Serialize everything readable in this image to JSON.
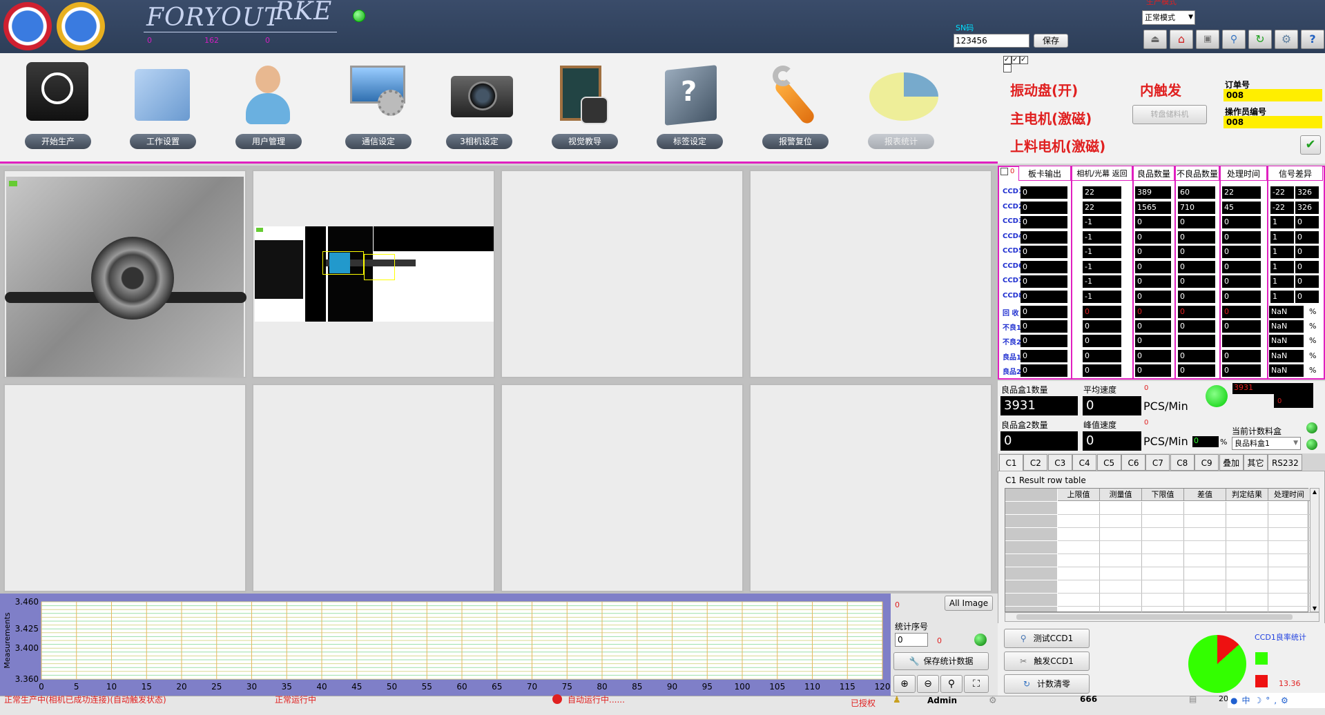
{
  "header": {
    "brand_left": "FORYOUT",
    "brand_right": "RKE",
    "sn_label": "SN码",
    "sn_value": "123456",
    "save_label": "保存",
    "num_0": "0",
    "num_162": "162",
    "num_0b": "0",
    "mode_label": "正常模式",
    "mode_caption": "生产模式"
  },
  "toolbar": {
    "items": [
      {
        "label": "开始生产"
      },
      {
        "label": "工作设置"
      },
      {
        "label": "用户管理"
      },
      {
        "label": "通信设定"
      },
      {
        "label": "3相机设定"
      },
      {
        "label": "视觉教导"
      },
      {
        "label": "标签设定"
      },
      {
        "label": "报警复位"
      },
      {
        "label": "报表统计"
      }
    ]
  },
  "control": {
    "vibe": "振动盘(开)",
    "main_motor": "主电机(激磁)",
    "feed_motor": "上料电机(激磁)",
    "internal_trigger": "内触发",
    "turntable_btn": "转盘储料机",
    "order_label": "订单号",
    "order_value": "008",
    "operator_label": "操作员编号",
    "operator_value": "008"
  },
  "table": {
    "zero": "0",
    "headers": [
      "板卡输出",
      "相机/光幕 返回",
      "良品数量",
      "不良品数量",
      "处理时间",
      "信号差异"
    ],
    "rows": [
      {
        "name": "CCD1",
        "c1": "0",
        "c2": "22",
        "c3": "389",
        "c4": "60",
        "c5": "22",
        "c6a": "-22",
        "c6b": "326"
      },
      {
        "name": "CCD2",
        "c1": "0",
        "c2": "22",
        "c3": "1565",
        "c4": "710",
        "c5": "45",
        "c6a": "-22",
        "c6b": "326"
      },
      {
        "name": "CCD3",
        "c1": "0",
        "c2": "-1",
        "c3": "0",
        "c4": "0",
        "c5": "0",
        "c6a": "1",
        "c6b": "0"
      },
      {
        "name": "CCD4",
        "c1": "0",
        "c2": "-1",
        "c3": "0",
        "c4": "0",
        "c5": "0",
        "c6a": "1",
        "c6b": "0"
      },
      {
        "name": "CCD5",
        "c1": "0",
        "c2": "-1",
        "c3": "0",
        "c4": "0",
        "c5": "0",
        "c6a": "1",
        "c6b": "0"
      },
      {
        "name": "CCD6",
        "c1": "0",
        "c2": "-1",
        "c3": "0",
        "c4": "0",
        "c5": "0",
        "c6a": "1",
        "c6b": "0"
      },
      {
        "name": "CCD7",
        "c1": "0",
        "c2": "-1",
        "c3": "0",
        "c4": "0",
        "c5": "0",
        "c6a": "1",
        "c6b": "0"
      },
      {
        "name": "CCD8",
        "c1": "0",
        "c2": "-1",
        "c3": "0",
        "c4": "0",
        "c5": "0",
        "c6a": "1",
        "c6b": "0"
      }
    ],
    "rows2": [
      {
        "name": "回 收",
        "c1": "0",
        "c2": "0",
        "c3": "0",
        "c4": "0",
        "c5": "0",
        "c6": "NaN"
      },
      {
        "name": "不良1",
        "c1": "0",
        "c2": "0",
        "c3": "0",
        "c4": "0",
        "c5": "0",
        "c6": "NaN"
      },
      {
        "name": "不良2",
        "c1": "0",
        "c2": "0",
        "c3": "0",
        "c4": "",
        "c5": "",
        "c6": "NaN"
      },
      {
        "name": "良品1",
        "c1": "0",
        "c2": "0",
        "c3": "0",
        "c4": "0",
        "c5": "0",
        "c6": "NaN"
      },
      {
        "name": "良品2",
        "c1": "0",
        "c2": "0",
        "c3": "0",
        "c4": "0",
        "c5": "0",
        "c6": "NaN"
      }
    ],
    "pct": "%"
  },
  "stats": {
    "good1_label": "良品盒1数量",
    "good1_value": "3931",
    "good2_label": "良品盒2数量",
    "good2_value": "0",
    "avg_label": "平均速度",
    "avg_value": "0",
    "peak_label": "峰值速度",
    "peak_value": "0",
    "unit": "PCS/Min",
    "red_small": "0",
    "red_small2": "0",
    "red_box": "3931",
    "red_box2": "0",
    "pct_value": "0",
    "pct": "%",
    "current_label": "当前计数料盒",
    "current_value": "良品料盒1"
  },
  "tabs": [
    "C1",
    "C2",
    "C3",
    "C4",
    "C5",
    "C6",
    "C7",
    "C8",
    "C9",
    "叠加",
    "其它",
    "RS232"
  ],
  "result": {
    "title": "C1 Result row table",
    "headers": [
      "上限值",
      "测量值",
      "下限值",
      "差值",
      "判定结果",
      "处理时间"
    ]
  },
  "buttons": {
    "test": "测试CCD1",
    "trigger": "触发CCD1",
    "clear": "计数清零",
    "save_stats": "保存统计数据",
    "all_image": "All Image",
    "stat_seq": "统计序号",
    "seq_value": "0",
    "seq_red": "0",
    "red_top": "0"
  },
  "pie": {
    "title": "CCD1良率统计",
    "good_pct": 86.64,
    "bad_pct": 13.36,
    "bad_label": "13.36",
    "good_color": "#33ff00",
    "bad_color": "#ee1111"
  },
  "chart_data": {
    "type": "line",
    "ylabel": "Measurements",
    "ylim": [
      3.36,
      3.46
    ],
    "yticks": [
      "3.460",
      "3.425",
      "3.400",
      "3.360"
    ],
    "xlim": [
      0,
      120
    ],
    "xticks": [
      "0",
      "5",
      "10",
      "15",
      "20",
      "25",
      "30",
      "35",
      "40",
      "45",
      "50",
      "55",
      "60",
      "65",
      "70",
      "75",
      "80",
      "85",
      "90",
      "95",
      "100",
      "105",
      "110",
      "115",
      "120"
    ],
    "series": []
  },
  "status": {
    "s1": "正常生产中(相机已成功连接)(自动触发状态)",
    "s2": "正常运行中",
    "s3": "自动运行中......",
    "s4": "已授权",
    "user": "Admin",
    "count": "666",
    "time": "20"
  }
}
